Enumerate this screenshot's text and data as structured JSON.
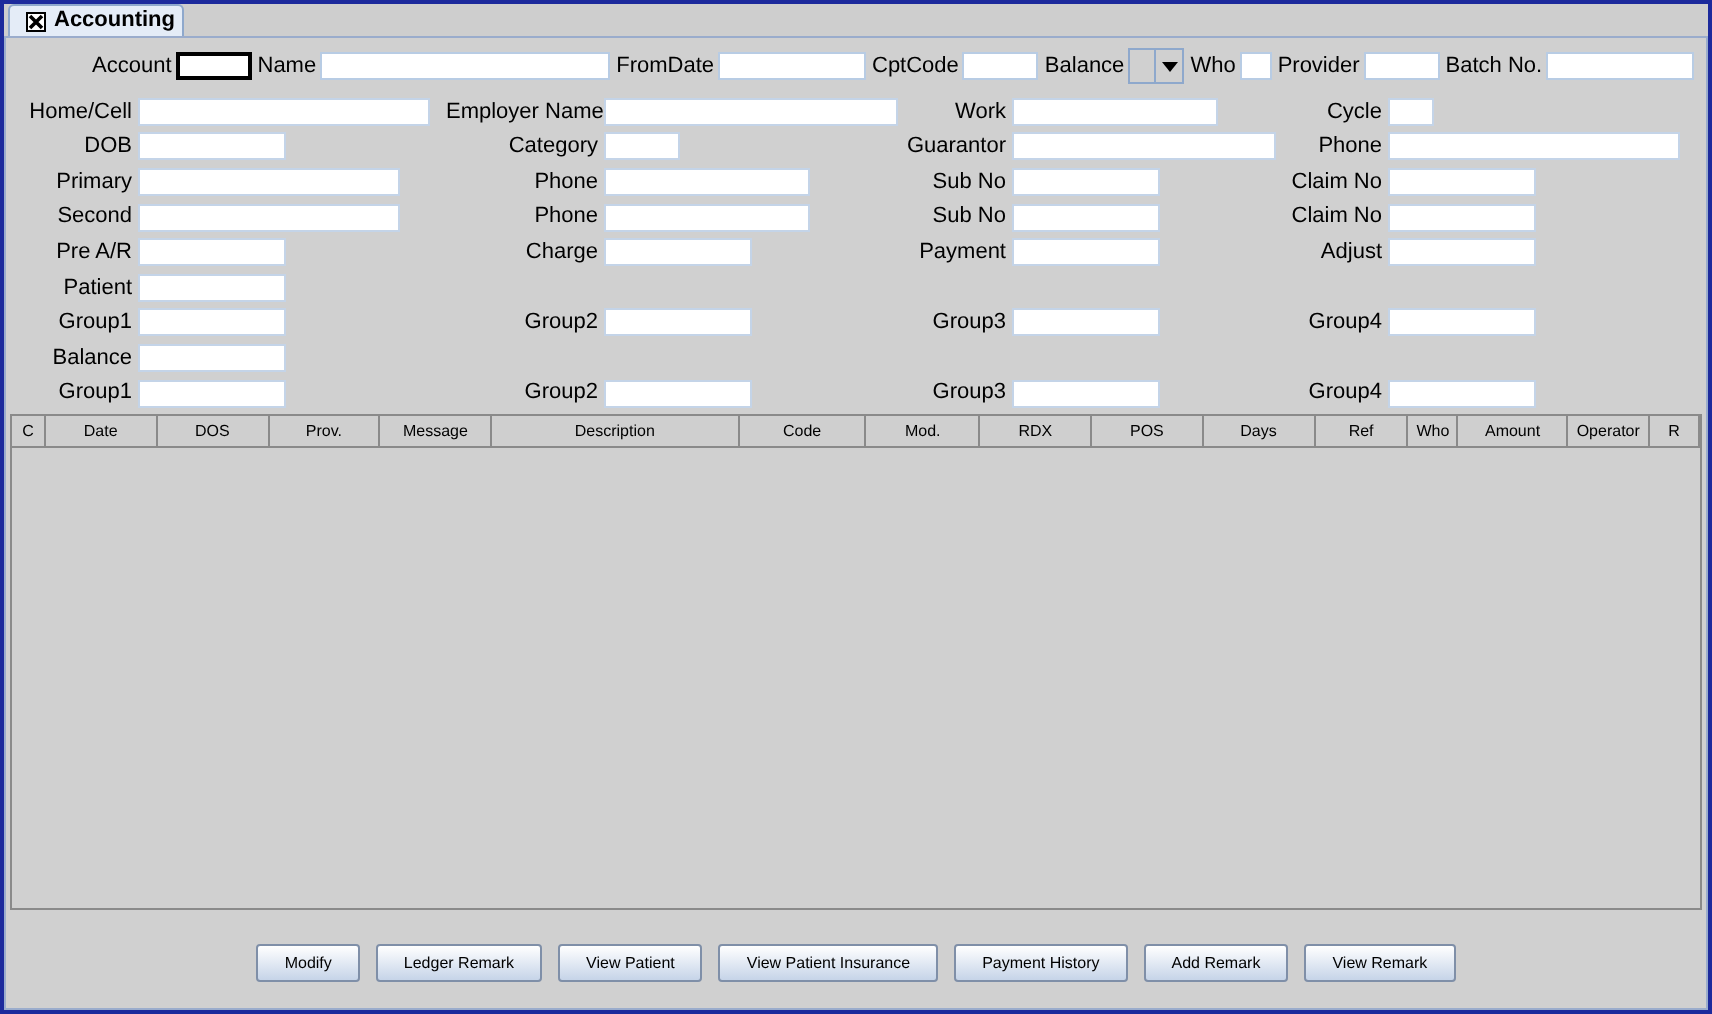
{
  "tab": {
    "label": "Accounting",
    "selected": true
  },
  "top_fields": [
    {
      "label": "Account",
      "kind": "field",
      "focused": true
    },
    {
      "label": "Name",
      "kind": "field",
      "focused": false
    },
    {
      "label": "FromDate",
      "kind": "field",
      "focused": false
    },
    {
      "label": "CptCode",
      "kind": "field",
      "focused": false
    },
    {
      "label": "Balance",
      "kind": "combo",
      "focused": false
    },
    {
      "label": "Who",
      "kind": "field",
      "focused": false
    },
    {
      "label": "Provider",
      "kind": "field",
      "focused": false
    },
    {
      "label": "Batch No.",
      "kind": "field",
      "focused": false
    }
  ],
  "form_rows": [
    [
      {
        "label": "Home/Cell"
      },
      {
        "label": "Employer Name"
      },
      {
        "label": "Work"
      },
      {
        "label": "Cycle"
      }
    ],
    [
      {
        "label": "DOB"
      },
      {
        "label": "Category"
      },
      {
        "label": "Guarantor"
      },
      {
        "label": "Phone"
      }
    ],
    [
      {
        "label": "Primary"
      },
      {
        "label": "Phone"
      },
      {
        "label": "Sub No"
      },
      {
        "label": "Claim No"
      }
    ],
    [
      {
        "label": "Second"
      },
      {
        "label": "Phone"
      },
      {
        "label": "Sub No"
      },
      {
        "label": "Claim No"
      }
    ],
    [
      {
        "label": "Pre A/R"
      },
      {
        "label": "Charge"
      },
      {
        "label": "Payment"
      },
      {
        "label": "Adjust"
      }
    ],
    [
      {
        "label": "Patient"
      }
    ],
    [
      {
        "label": "Group1"
      },
      {
        "label": "Group2"
      },
      {
        "label": "Group3"
      },
      {
        "label": "Group4"
      }
    ],
    [
      {
        "label": "Balance"
      }
    ],
    [
      {
        "label": "Group1"
      },
      {
        "label": "Group2"
      },
      {
        "label": "Group3"
      },
      {
        "label": "Group4"
      }
    ]
  ],
  "table": {
    "columns": [
      "C",
      "Date",
      "DOS",
      "Prov.",
      "Message",
      "Description",
      "Code",
      "Mod.",
      "RDX",
      "POS",
      "Days",
      "Ref",
      "Who",
      "Amount",
      "Operator",
      "R"
    ]
  },
  "buttons": [
    "Modify",
    "Ledger Remark",
    "View Patient",
    "View Patient Insurance",
    "Payment History",
    "Add Remark",
    "View Remark"
  ]
}
